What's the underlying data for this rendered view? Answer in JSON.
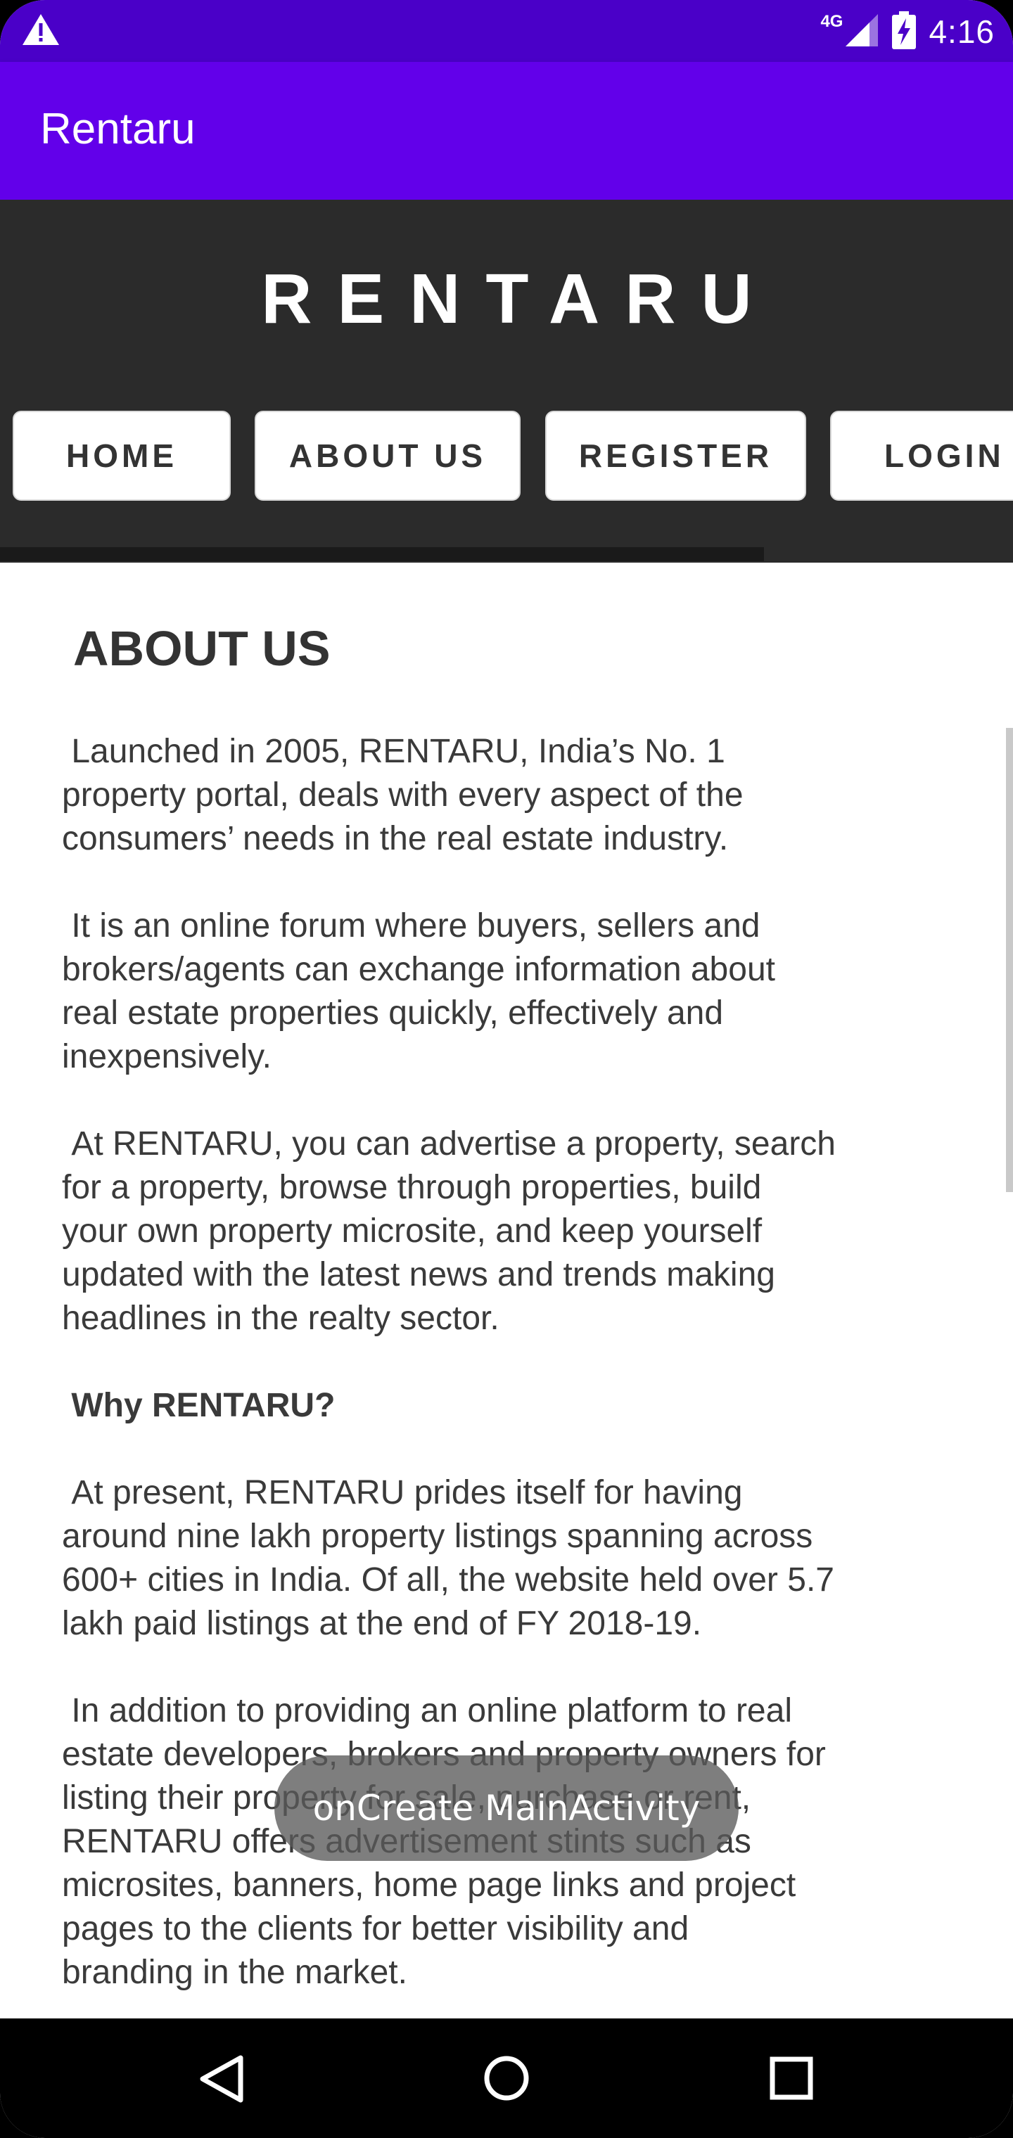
{
  "status_bar": {
    "network_label": "4G",
    "time": "4:16",
    "icons": [
      "warning-icon",
      "signal-icon",
      "battery-charging-icon"
    ]
  },
  "app_bar": {
    "title": "Rentaru"
  },
  "site": {
    "logo": "RENTARU",
    "nav": [
      "HOME",
      "ABOUT US",
      "REGISTER",
      "LOGIN"
    ]
  },
  "content": {
    "title": "ABOUT US",
    "paragraphs": [
      " Launched in 2005, RENTARU, India’s No. 1\nproperty portal, deals with every aspect of the\nconsumers’ needs in the real estate industry.",
      " It is an online forum where buyers, sellers and\nbrokers/agents can exchange information about\nreal estate properties quickly, effectively and\ninexpensively.",
      " At RENTARU, you can advertise a property, search\nfor a property, browse through properties, build\nyour own property microsite, and keep yourself\nupdated with the latest news and trends making\nheadlines in the realty sector.",
      " Why RENTARU?",
      " At present, RENTARU prides itself for having\naround nine lakh property listings spanning across\n600+ cities in India. Of all, the website held over 5.7\nlakh paid listings at the end of FY 2018-19.",
      " In addition to providing an online platform to real\nestate developers, brokers and property owners for\nlisting their property for sale, purchase or rent,\nRENTARU offers advertisement stints such as\nmicrosites, banners, home page links and project\npages to the clients for better visibility and\nbranding in the market."
    ]
  },
  "toast": {
    "text": "onCreate MainActivity"
  },
  "nav_bar": {
    "icons": [
      "back-icon",
      "home-icon",
      "recents-icon"
    ]
  },
  "colors": {
    "status_bar": "#4a00c8",
    "app_bar": "#6200ea",
    "site_header": "#2b2b2b"
  }
}
